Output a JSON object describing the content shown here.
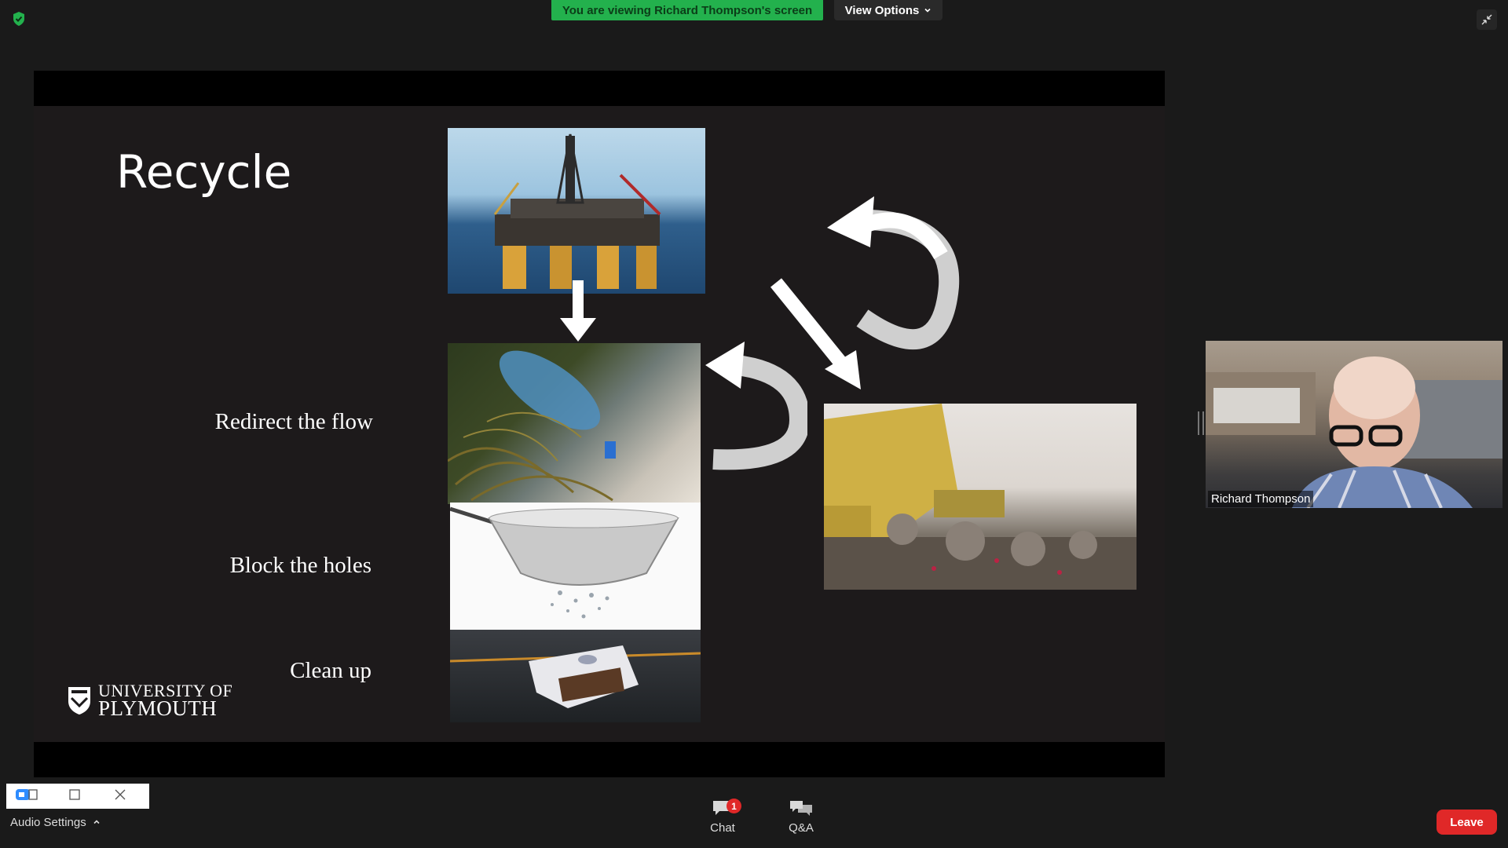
{
  "banner": {
    "viewing_text": "You are viewing Richard Thompson's screen",
    "view_options_label": "View Options"
  },
  "slide": {
    "title": "Recycle",
    "labels": [
      "Redirect the flow",
      "Block the holes",
      "Clean up"
    ],
    "logo": {
      "line1": "UNIVERSITY OF",
      "line2": "PLYMOUTH"
    }
  },
  "participant": {
    "name": "Richard Thompson"
  },
  "toolbar": {
    "audio_settings_label": "Audio Settings",
    "chat_label": "Chat",
    "chat_badge": "1",
    "qa_label": "Q&A",
    "leave_label": "Leave"
  },
  "colors": {
    "banner_green": "#23b14d",
    "leave_red": "#e02828"
  }
}
